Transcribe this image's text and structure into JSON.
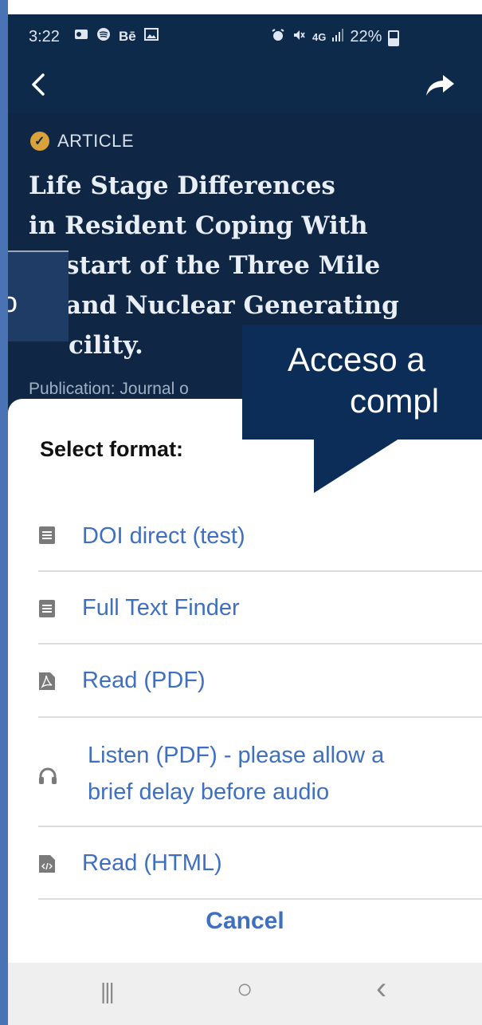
{
  "status_bar": {
    "time": "3:22",
    "left_icons": [
      "outlook-icon",
      "spotify-icon",
      "behance-icon",
      "gallery-icon"
    ],
    "behance_text": "Bē",
    "right_icons": [
      "alarm-icon",
      "mute-icon",
      "lte-icon",
      "signal-icon"
    ],
    "lte_text": "4G",
    "battery_text": "22%"
  },
  "app_bar": {
    "back_icon": "chevron-left-icon",
    "share_icon": "share-arrow-icon"
  },
  "article": {
    "type_label": "ARTICLE",
    "title_lines": [
      "Life Stage Differences",
      "in Resident Coping With",
      "start of the Three Mile",
      "and Nuclear Generating",
      "cility."
    ],
    "publication": "Publication: Journal o"
  },
  "overlays": {
    "left_callout_text": "o",
    "right_callout_line1": "Acceso a",
    "right_callout_line2": "compl"
  },
  "sheet": {
    "title": "Select format:",
    "options": [
      {
        "icon": "document-icon",
        "label": "DOI direct (test)"
      },
      {
        "icon": "document-icon",
        "label": "Full Text Finder"
      },
      {
        "icon": "pdf-icon",
        "label": "Read (PDF)"
      },
      {
        "icon": "headphones-icon",
        "label_line1": "Listen (PDF) - please allow a",
        "label_line2": "brief delay before audio"
      },
      {
        "icon": "html-icon",
        "label": "Read (HTML)"
      }
    ],
    "cancel_label": "Cancel"
  },
  "nav_bar": {
    "recents": "|||",
    "home": "○",
    "back": "‹"
  },
  "colors": {
    "header_bg": "#0e2a4b",
    "accent_link": "#3f6fc0",
    "callout_bg": "#0c2d57",
    "badge": "#d9a23a"
  }
}
